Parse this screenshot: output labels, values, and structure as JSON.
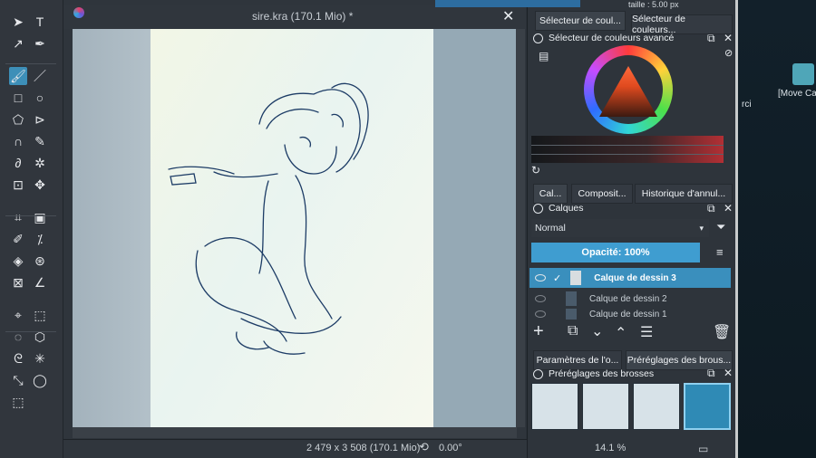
{
  "document": {
    "title": "sire.kra (170.1 Mio) *",
    "close_glyph": "✕"
  },
  "toolbar_top": {
    "size_label": "taille : 5.00 px"
  },
  "tools": [
    {
      "name": "select-icon",
      "glyph": "➤"
    },
    {
      "name": "text-tool-icon",
      "glyph": "T"
    },
    {
      "name": "edit-shapes-icon",
      "glyph": "↗"
    },
    {
      "name": "calligraphy-icon",
      "glyph": "✒"
    },
    {
      "name": "brush-icon",
      "glyph": "🖌"
    },
    {
      "name": "line-icon",
      "glyph": "／"
    },
    {
      "name": "rectangle-icon",
      "glyph": "□"
    },
    {
      "name": "ellipse-icon",
      "glyph": "○"
    },
    {
      "name": "polygon-icon",
      "glyph": "⬠"
    },
    {
      "name": "polyline-icon",
      "glyph": "⊳"
    },
    {
      "name": "bezier-icon",
      "glyph": "∩"
    },
    {
      "name": "freehand-path-icon",
      "glyph": "✎"
    },
    {
      "name": "dynamic-brush-icon",
      "glyph": "∂"
    },
    {
      "name": "multibrush-icon",
      "glyph": "✲"
    },
    {
      "name": "transform-icon",
      "glyph": "⊡"
    },
    {
      "name": "move-icon",
      "glyph": "✥"
    },
    {
      "name": "crop-icon",
      "glyph": "⌗"
    },
    {
      "name": "gradient-icon",
      "glyph": "▣"
    },
    {
      "name": "color-picker-icon",
      "glyph": "✐"
    },
    {
      "name": "colorize-mask-icon",
      "glyph": "⁒"
    },
    {
      "name": "fill-icon",
      "glyph": "◈"
    },
    {
      "name": "pattern-icon",
      "glyph": "⊛"
    },
    {
      "name": "assistant-icon",
      "glyph": "⊠"
    },
    {
      "name": "measure-icon",
      "glyph": "∠"
    },
    {
      "name": "reference-icon",
      "glyph": "⌖"
    },
    {
      "name": "rect-select-icon",
      "glyph": "⬚"
    },
    {
      "name": "ellipse-select-icon",
      "glyph": "◌"
    },
    {
      "name": "polygon-select-icon",
      "glyph": "⬡"
    },
    {
      "name": "freehand-select-icon",
      "glyph": "ᘓ"
    },
    {
      "name": "contiguous-select-icon",
      "glyph": "✳"
    },
    {
      "name": "similar-select-icon",
      "glyph": "⤡"
    },
    {
      "name": "bezier-select-icon",
      "glyph": "◯"
    },
    {
      "name": "magnetic-select-icon",
      "glyph": "⬚"
    }
  ],
  "dockers": {
    "top_tabs": [
      "Sélecteur de coul...",
      "Sélecteur de couleurs..."
    ],
    "advanced_color_title": "Sélecteur de couleurs avancé",
    "middle_tabs": [
      "Cal...",
      "Composit...",
      "Historique d'annul..."
    ],
    "layers_title": "Calques",
    "blend_mode": "Normal",
    "opacity_label": "Opacité:  100%",
    "layers": [
      {
        "name": "Calque de dessin 3",
        "visible": true,
        "selected": true
      },
      {
        "name": "Calque de dessin 2",
        "visible": false,
        "selected": false
      },
      {
        "name": "Calque de dessin 1",
        "visible": false,
        "selected": false
      }
    ],
    "bottom_tabs": [
      "Paramètres de l'o...",
      "Préréglages des brous..."
    ],
    "presets_title": "Préréglages des brosses"
  },
  "status": {
    "dimensions": "2 479 x 3 508 (170.1 Mio)",
    "rotation": "0.00°",
    "zoom": "14.1 %"
  },
  "desktop": {
    "shortcut_label": "[Move Ca",
    "partial_text": "rci"
  },
  "colors": {
    "accent": "#3d8fb8",
    "selected_layer": "#3a8fbd",
    "opacity_bar": "#3f9dd0"
  }
}
